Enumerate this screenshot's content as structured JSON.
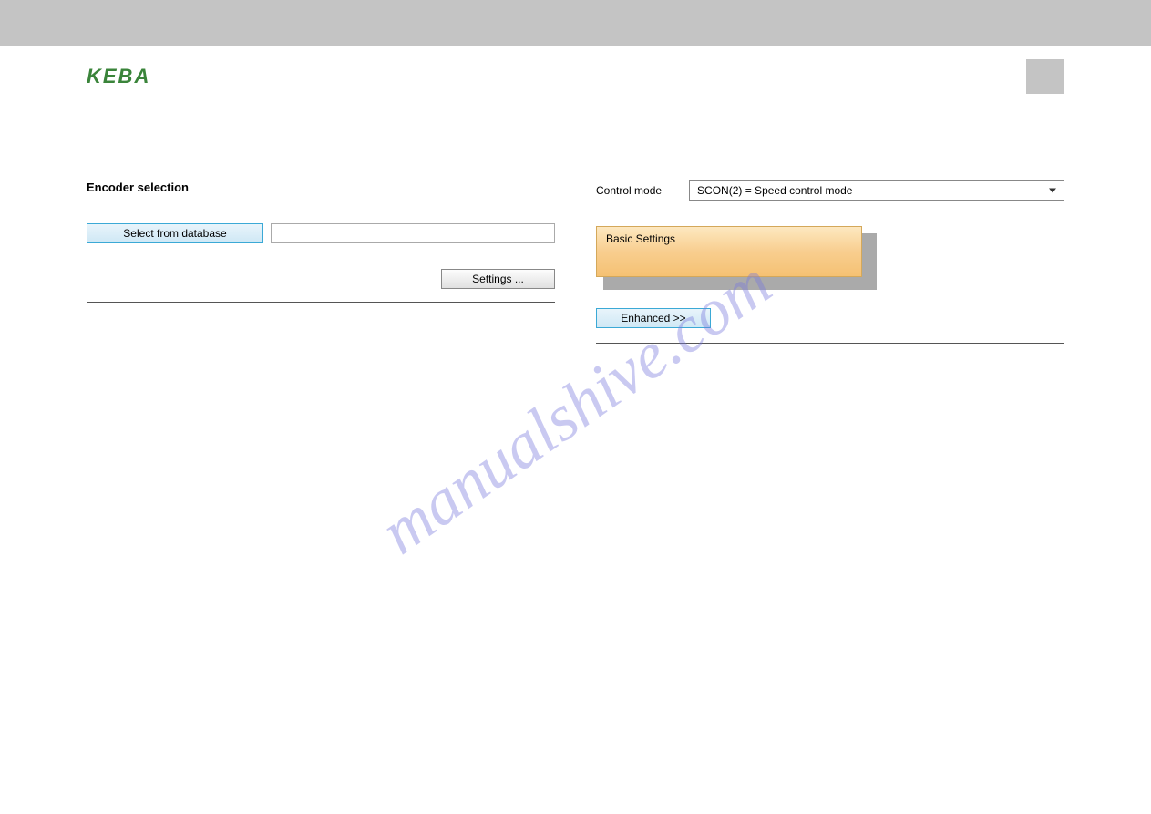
{
  "header": {
    "logo_text": "KEBA"
  },
  "left": {
    "title": "Encoder selection",
    "select_db_button": "Select from database",
    "db_input_value": "",
    "settings_button": "Settings ..."
  },
  "right": {
    "control_mode_label": "Control mode",
    "control_mode_value": "SCON(2) = Speed control mode",
    "basic_settings_label": "Basic Settings",
    "enhanced_button": "Enhanced >>"
  },
  "watermark": "manualshive.com"
}
